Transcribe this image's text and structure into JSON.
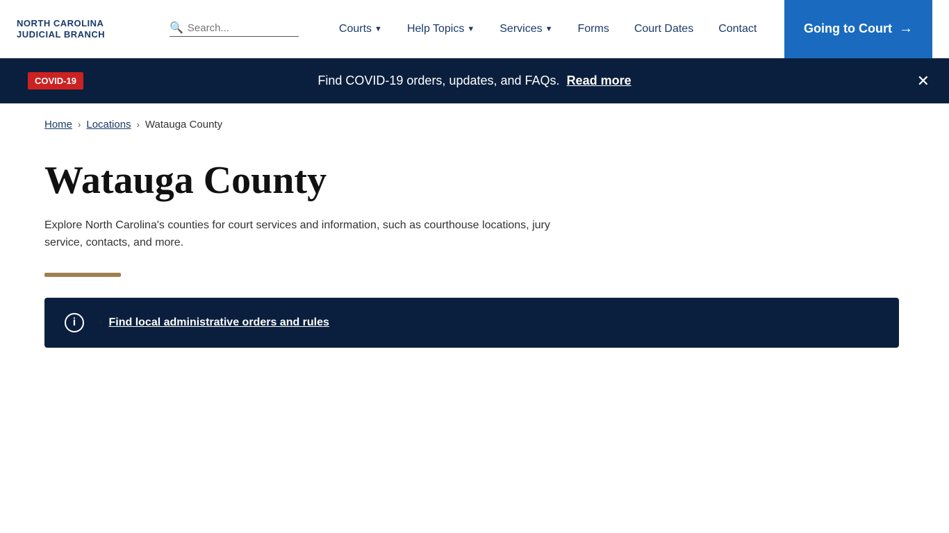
{
  "header": {
    "logo_line1": "NORTH CAROLINA",
    "logo_line2": "JUDICIAL BRANCH",
    "search_placeholder": "Search...",
    "nav": [
      {
        "label": "Courts",
        "has_chevron": true
      },
      {
        "label": "Help Topics",
        "has_chevron": true
      },
      {
        "label": "Services",
        "has_chevron": true
      },
      {
        "label": "Forms",
        "has_chevron": false
      },
      {
        "label": "Court Dates",
        "has_chevron": false
      },
      {
        "label": "Contact",
        "has_chevron": false
      }
    ],
    "cta_label": "Going to Court",
    "cta_arrow": "→"
  },
  "covid_banner": {
    "badge_label": "COVID-19",
    "message": "Find COVID-19 orders, updates, and FAQs.",
    "link_label": "Read more",
    "close_aria": "Close"
  },
  "breadcrumb": {
    "home": "Home",
    "locations": "Locations",
    "current": "Watauga County"
  },
  "page": {
    "title": "Watauga County",
    "description": "Explore North Carolina's counties for court services and information, such as courthouse locations, jury service, contacts, and more.",
    "info_box_link": "Find local administrative orders and rules"
  },
  "icons": {
    "search": "🔍",
    "chevron_down": "▾",
    "close": "✕",
    "info": "ⓘ",
    "arrow_right": "→"
  },
  "colors": {
    "brand_blue": "#1a3a6b",
    "cta_blue": "#1a6bbf",
    "dark_navy": "#0a1f3d",
    "covid_red": "#cc2222",
    "gold": "#a08050"
  }
}
